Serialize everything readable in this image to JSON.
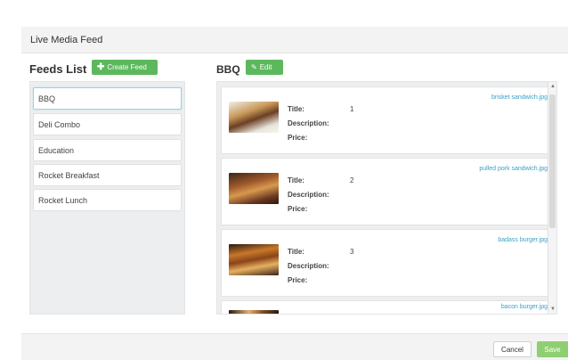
{
  "header": {
    "title": "Live Media Feed"
  },
  "feeds": {
    "heading": "Feeds List",
    "create_label": "Create Feed",
    "items": [
      {
        "label": "BBQ"
      },
      {
        "label": "Deli Combo"
      },
      {
        "label": "Education"
      },
      {
        "label": "Rocket Breakfast"
      },
      {
        "label": "Rocket Lunch"
      }
    ]
  },
  "feed": {
    "title": "BBQ",
    "edit_label": "Edit",
    "field_labels": {
      "title": "Title:",
      "description": "Description:",
      "price": "Price:"
    },
    "media": [
      {
        "title_value": "1",
        "filename": "brisket sandwich.jpg"
      },
      {
        "title_value": "2",
        "filename": "pulled pork sandwich.jpg"
      },
      {
        "title_value": "3",
        "filename": "badass burger.jpg"
      },
      {
        "title_value": "",
        "filename": "bacon burger.jpg"
      }
    ]
  },
  "footer": {
    "cancel_label": "Cancel",
    "save_label": "Save"
  },
  "colors": {
    "primary_green": "#5cb85c",
    "link_blue": "#3aa0c7",
    "panel_bg": "#eceeef"
  },
  "icons": {
    "create": "plus-icon",
    "edit": "pencil-icon"
  }
}
